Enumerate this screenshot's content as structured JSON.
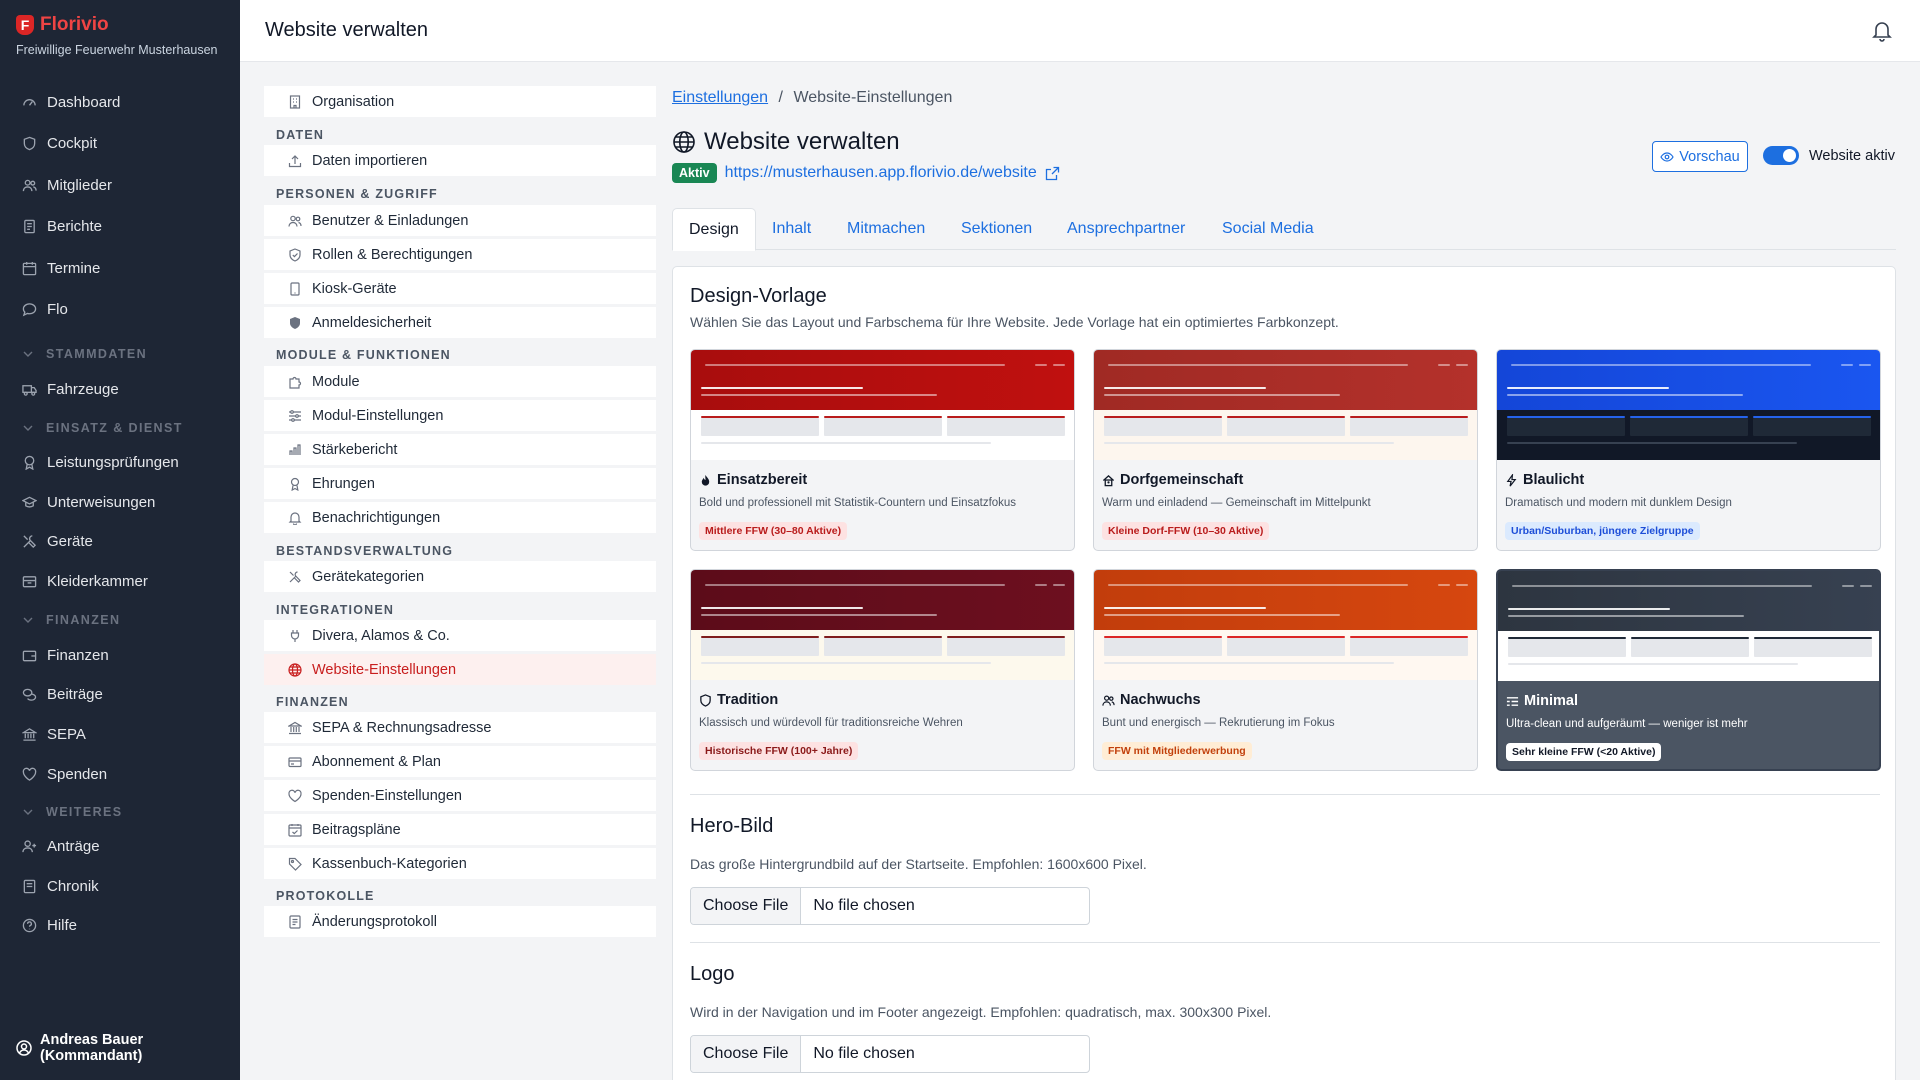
{
  "sidebar": {
    "brand": "Florivio",
    "org": "Freiwillige Feuerwehr Musterhausen",
    "items": {
      "dashboard": "Dashboard",
      "cockpit": "Cockpit",
      "mitglieder": "Mitglieder",
      "berichte": "Berichte",
      "termine": "Termine",
      "flo": "Flo",
      "fahrzeuge": "Fahrzeuge",
      "leistung": "Leistungsprüfungen",
      "unterweisungen": "Unterweisungen",
      "geraete": "Geräte",
      "kleiderkammer": "Kleiderkammer",
      "finanzen": "Finanzen",
      "beitraege": "Beiträge",
      "sepa": "SEPA",
      "spenden": "Spenden",
      "antraege": "Anträge",
      "chronik": "Chronik",
      "hilfe": "Hilfe"
    },
    "sections": {
      "stammdaten": "STAMMDATEN",
      "einsatz": "EINSATZ & DIENST",
      "finanzen": "FINANZEN",
      "weiteres": "WEITERES"
    },
    "user": "Andreas Bauer (Kommandant)"
  },
  "topbar": {
    "title": "Website verwalten"
  },
  "settings_nav": {
    "organisation": "Organisation",
    "h_daten": "DATEN",
    "daten_importieren": "Daten importieren",
    "h_personen": "PERSONEN & ZUGRIFF",
    "benutzer": "Benutzer & Einladungen",
    "rollen": "Rollen & Berechtigungen",
    "kiosk": "Kiosk-Geräte",
    "anmelde": "Anmeldesicherheit",
    "h_module": "MODULE & FUNKTIONEN",
    "module": "Module",
    "modul_einst": "Modul-Einstellungen",
    "staerke": "Stärkebericht",
    "ehrungen": "Ehrungen",
    "benachr": "Benachrichtigungen",
    "h_bestand": "BESTANDSVERWALTUNG",
    "geraetekat": "Gerätekategorien",
    "h_integr": "INTEGRATIONEN",
    "divera": "Divera, Alamos & Co.",
    "website": "Website-Einstellungen",
    "h_finanzen": "FINANZEN",
    "sepa_rech": "SEPA & Rechnungsadresse",
    "abo": "Abonnement & Plan",
    "spenden_einst": "Spenden-Einstellungen",
    "beitragsplaene": "Beitragspläne",
    "kassenbuch": "Kassenbuch-Kategorien",
    "h_protokolle": "PROTOKOLLE",
    "aenderung": "Änderungsprotokoll"
  },
  "breadcrumb": {
    "link": "Einstellungen",
    "sep": "/",
    "current": "Website-Einstellungen"
  },
  "page": {
    "title": "Website verwalten",
    "status": "Aktiv",
    "url": "https://musterhausen.app.florivio.de/website",
    "preview": "Vorschau",
    "toggle_label": "Website aktiv",
    "toggle_on": true
  },
  "tabs": [
    "Design",
    "Inhalt",
    "Mitmachen",
    "Sektionen",
    "Ansprechpartner",
    "Social Media"
  ],
  "design": {
    "title": "Design-Vorlage",
    "desc": "Wählen Sie das Layout und Farbschema für Ihre Website. Jede Vorlage hat ein optimiertes Farbkonzept.",
    "templates": [
      {
        "name": "Einsatzbereit",
        "desc": "Bold und professionell mit Statistik-Countern und Einsatzfokus",
        "tag": "Mittlere FFW (30–80 Aktive)",
        "icon": "flame-icon",
        "hero": "#c0100f",
        "heroTop": "#a80d0d",
        "body": "#ffffff",
        "accent": "#b91c1c",
        "tagBg": "#fde2e2",
        "tagFg": "#b91c1c"
      },
      {
        "name": "Dorfgemeinschaft",
        "desc": "Warm und einladend — Gemeinschaft im Mittelpunkt",
        "tag": "Kleine Dorf-FFW (10–30 Aktive)",
        "icon": "house-icon",
        "hero": "#b4312b",
        "heroTop": "#a02a24",
        "body": "#fdf6ee",
        "accent": "#b91c1c",
        "tagBg": "#fde2e2",
        "tagFg": "#b91c1c"
      },
      {
        "name": "Blaulicht",
        "desc": "Dramatisch und modern mit dunklem Design",
        "tag": "Urban/Suburban, jüngere Zielgruppe",
        "icon": "bolt-icon",
        "hero": "#1a56f0",
        "heroTop": "#1446d8",
        "body": "#111827",
        "accent": "#2563eb",
        "tagBg": "#dbeafe",
        "tagFg": "#1d4ed8"
      },
      {
        "name": "Tradition",
        "desc": "Klassisch und würdevoll für traditionsreiche Wehren",
        "tag": "Historische FFW (100+ Jahre)",
        "icon": "shield-icon",
        "hero": "#6d0f1f",
        "heroTop": "#5c0c19",
        "body": "#fdf9ed",
        "accent": "#7f1d1d",
        "tagBg": "#fde2e2",
        "tagFg": "#8b1a1a"
      },
      {
        "name": "Nachwuchs",
        "desc": "Bunt und energisch — Rekrutierung im Fokus",
        "tag": "FFW mit Mitgliederwerbung",
        "icon": "people-icon",
        "hero": "#d6470f",
        "heroTop": "#c23d0c",
        "body": "#fff8f1",
        "accent": "#dc2626",
        "tagBg": "#ffedd5",
        "tagFg": "#c2410c"
      },
      {
        "name": "Minimal",
        "desc": "Ultra-clean und aufgeräumt — weniger ist mehr",
        "tag": "Sehr kleine FFW (<20 Aktive)",
        "icon": "list-icon",
        "hero": "#374151",
        "heroTop": "#2d3540",
        "body": "#ffffff",
        "accent": "#1f2937",
        "tagBg": "#ffffff",
        "tagFg": "#111827",
        "selected": true
      }
    ]
  },
  "hero": {
    "title": "Hero-Bild",
    "desc": "Das große Hintergrundbild auf der Startseite. Empfohlen: 1600x600 Pixel.",
    "button": "Choose File",
    "value": "No file chosen"
  },
  "logo": {
    "title": "Logo",
    "desc": "Wird in der Navigation und im Footer angezeigt. Empfohlen: quadratisch, max. 300x300 Pixel.",
    "button": "Choose File",
    "value": "No file chosen"
  }
}
